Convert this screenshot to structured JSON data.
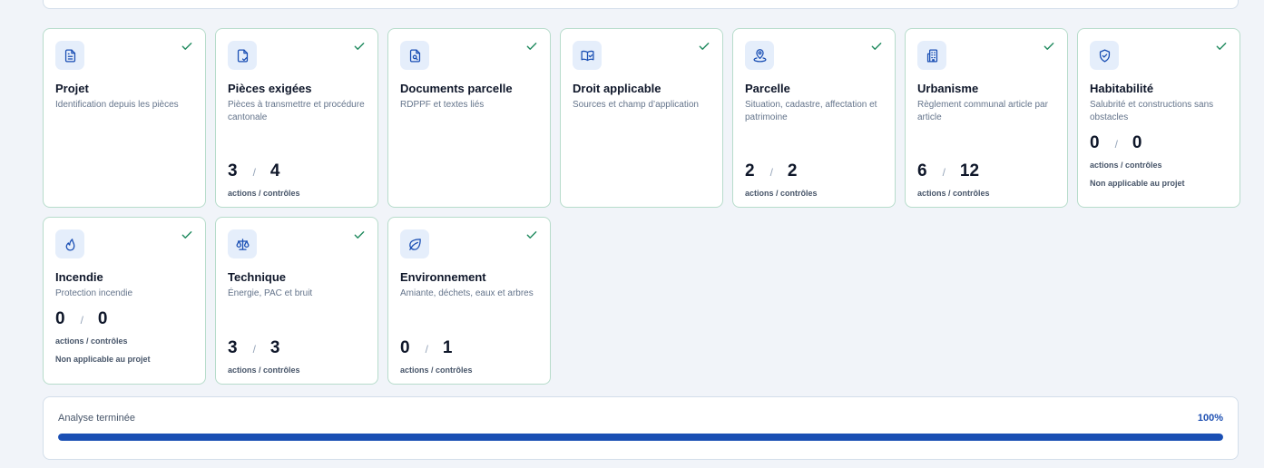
{
  "colors": {
    "accent": "#1a4fb4",
    "check": "#1f8a5e",
    "icon_bg": "#e5eefb",
    "card_border": "#b7dccb"
  },
  "cards": [
    {
      "icon": "document-icon",
      "title": "Projet",
      "desc": "Identification depuis les pièces"
    },
    {
      "icon": "document-check-icon",
      "title": "Pièces exigées",
      "desc": "Pièces à transmettre et procédure cantonale",
      "done": "3",
      "total": "4",
      "counts_label": "actions / contrôles"
    },
    {
      "icon": "document-search-icon",
      "title": "Documents parcelle",
      "desc": "RDPPF et textes liés"
    },
    {
      "icon": "book-check-icon",
      "title": "Droit applicable",
      "desc": "Sources et champ d’application"
    },
    {
      "icon": "map-pin-icon",
      "title": "Parcelle",
      "desc": "Situation, cadastre, affectation et patrimoine",
      "done": "2",
      "total": "2",
      "counts_label": "actions / contrôles"
    },
    {
      "icon": "building-icon",
      "title": "Urbanisme",
      "desc": "Règlement communal article par article",
      "done": "6",
      "total": "12",
      "counts_label": "actions / contrôles"
    },
    {
      "icon": "shield-check-icon",
      "title": "Habitabilité",
      "desc": "Salubrité et constructions sans obstacles",
      "done": "0",
      "total": "0",
      "counts_label": "actions / contrôles",
      "note": "Non applicable au projet"
    },
    {
      "icon": "flame-icon",
      "title": "Incendie",
      "desc": "Protection incendie",
      "done": "0",
      "total": "0",
      "counts_label": "actions / contrôles",
      "note": "Non applicable au projet"
    },
    {
      "icon": "scale-icon",
      "title": "Technique",
      "desc": "Énergie, PAC et bruit",
      "done": "3",
      "total": "3",
      "counts_label": "actions / contrôles"
    },
    {
      "icon": "leaf-icon",
      "title": "Environnement",
      "desc": "Amiante, déchets, eaux et arbres",
      "done": "0",
      "total": "1",
      "counts_label": "actions / contrôles"
    }
  ],
  "progress": {
    "label": "Analyse terminée",
    "percent_label": "100%",
    "value": 1.0
  }
}
